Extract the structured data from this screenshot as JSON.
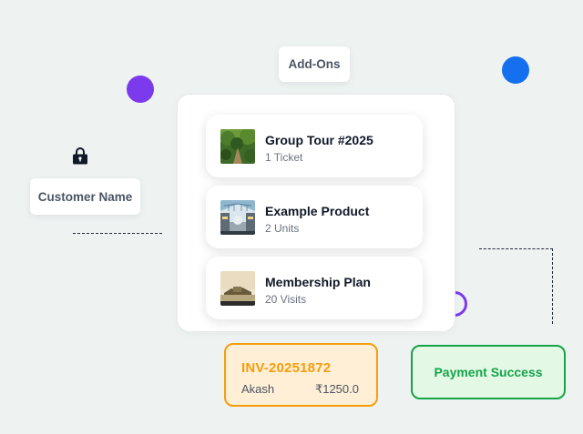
{
  "addons_chip": {
    "label": "Add-Ons"
  },
  "customer_chip": {
    "label": "Customer Name"
  },
  "cart": {
    "items": [
      {
        "title": "Group Tour #2025",
        "subtitle": "1 Ticket",
        "thumb_icon": "forest-trail-photo"
      },
      {
        "title": "Example Product",
        "subtitle": "2 Units",
        "thumb_icon": "mall-atrium-photo"
      },
      {
        "title": "Membership Plan",
        "subtitle": "20 Visits",
        "thumb_icon": "waterfront-building-photo"
      }
    ]
  },
  "invoice": {
    "number": "INV-20251872",
    "customer": "Akash",
    "amount": "₹1250.0"
  },
  "payment": {
    "status": "Payment Success"
  },
  "colors": {
    "background": "#eef3f2",
    "purple": "#7c3aed",
    "blue": "#1570ef",
    "invoice_accent": "#f59e0b",
    "invoice_fill": "#ffefd6",
    "success_accent": "#16a34a",
    "success_fill": "#e3f9e5"
  },
  "icons": {
    "lock": "lock-icon"
  }
}
